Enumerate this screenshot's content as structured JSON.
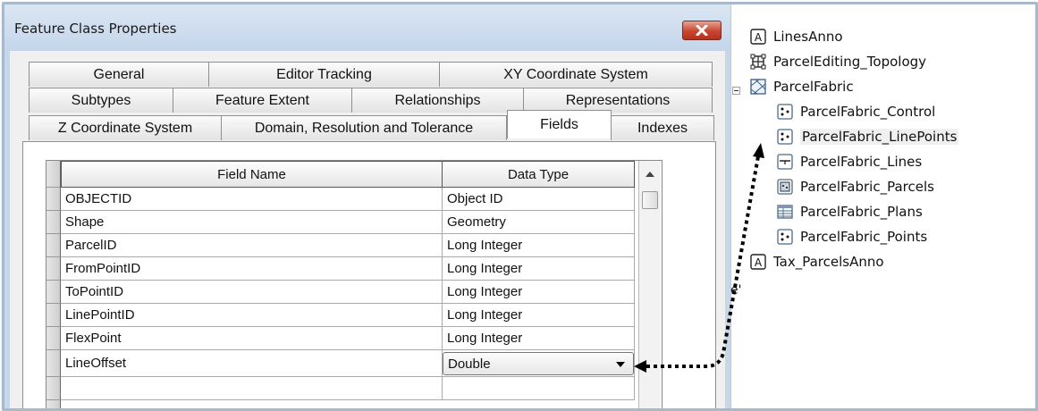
{
  "dialog": {
    "title": "Feature Class Properties",
    "tabs": {
      "row1": [
        "General",
        "Editor Tracking",
        "XY Coordinate System"
      ],
      "row2": [
        "Subtypes",
        "Feature Extent",
        "Relationships",
        "Representations"
      ],
      "row3": [
        "Z Coordinate System",
        "Domain, Resolution and Tolerance",
        "Fields",
        "Indexes"
      ],
      "active": "Fields"
    },
    "grid": {
      "headers": [
        "Field Name",
        "Data Type"
      ],
      "rows": [
        {
          "name": "OBJECTID",
          "type": "Object ID"
        },
        {
          "name": "Shape",
          "type": "Geometry"
        },
        {
          "name": "ParcelID",
          "type": "Long Integer"
        },
        {
          "name": "FromPointID",
          "type": "Long Integer"
        },
        {
          "name": "ToPointID",
          "type": "Long Integer"
        },
        {
          "name": "LinePointID",
          "type": "Long Integer"
        },
        {
          "name": "FlexPoint",
          "type": "Long Integer"
        },
        {
          "name": "LineOffset",
          "type": "Double"
        }
      ]
    }
  },
  "tree": {
    "items": [
      {
        "label": "LinesAnno",
        "icon": "annotation-icon"
      },
      {
        "label": "ParcelEditing_Topology",
        "icon": "topology-icon"
      },
      {
        "label": "ParcelFabric",
        "icon": "parcel-fabric-icon"
      },
      {
        "label": "ParcelFabric_Control",
        "icon": "point-feature-class-icon"
      },
      {
        "label": "ParcelFabric_LinePoints",
        "icon": "point-feature-class-icon"
      },
      {
        "label": "ParcelFabric_Lines",
        "icon": "line-feature-class-icon"
      },
      {
        "label": "ParcelFabric_Parcels",
        "icon": "polygon-feature-class-icon"
      },
      {
        "label": "ParcelFabric_Plans",
        "icon": "table-icon"
      },
      {
        "label": "ParcelFabric_Points",
        "icon": "point-feature-class-icon"
      },
      {
        "label": "Tax_ParcelsAnno",
        "icon": "annotation-icon"
      }
    ],
    "fragment": "e'"
  },
  "colors": {
    "frame": "#a9b9cc",
    "titlebar": "#c7d7ea",
    "close_button": "#c8462f",
    "arrow": "#000000"
  }
}
